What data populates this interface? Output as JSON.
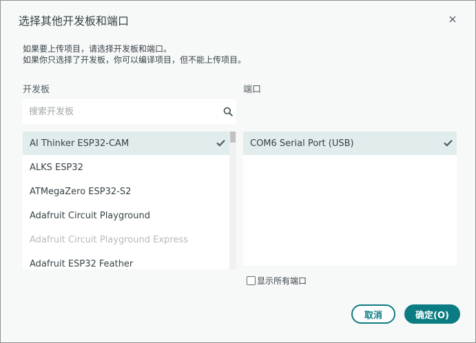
{
  "dialog": {
    "title": "选择其他开发板和端口",
    "close_icon": "close-icon",
    "description_line1": "如果要上传项目，请选择开发板和端口。",
    "description_line2": "如果你只选择了开发板，你可以编译项目，但不能上传项目。"
  },
  "boards": {
    "label": "开发板",
    "search_placeholder": "搜索开发板",
    "search_icon": "search-icon",
    "items": [
      {
        "label": "AI Thinker ESP32-CAM",
        "selected": true,
        "disabled": false
      },
      {
        "label": "ALKS ESP32",
        "selected": false,
        "disabled": false
      },
      {
        "label": "ATMegaZero ESP32-S2",
        "selected": false,
        "disabled": false
      },
      {
        "label": "Adafruit Circuit Playground",
        "selected": false,
        "disabled": false
      },
      {
        "label": "Adafruit Circuit Playground Express",
        "selected": false,
        "disabled": true
      },
      {
        "label": "Adafruit ESP32 Feather",
        "selected": false,
        "disabled": false
      }
    ]
  },
  "ports": {
    "label": "端口",
    "items": [
      {
        "label": "COM6 Serial Port (USB)",
        "selected": true
      }
    ],
    "show_all_label": "显示所有端口",
    "show_all_checked": false
  },
  "buttons": {
    "cancel": "取消",
    "ok": "确定(O)"
  },
  "colors": {
    "accent": "#0b7c82",
    "selected_row": "#e1ecec",
    "disabled_text": "#b5b9bb"
  }
}
